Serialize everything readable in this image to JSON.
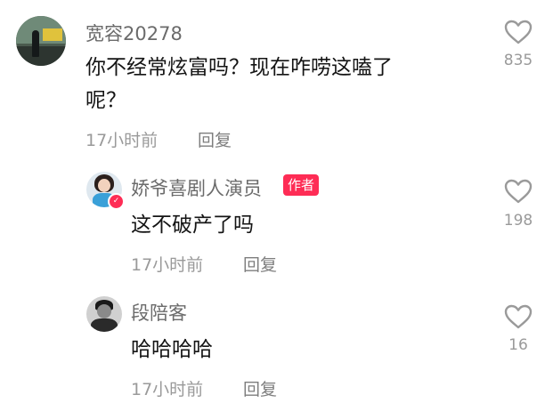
{
  "comments": [
    {
      "username": "宽容20278",
      "text_line1": "你不经常炫富吗？现在咋唠这嗑了",
      "text_line2": "呢？",
      "time": "17小时前",
      "reply_label": "回复",
      "like_count": "835",
      "icons": {
        "avatar": "user-avatar-icon",
        "like": "heart-icon"
      }
    },
    {
      "username": "娇爷喜剧人演员",
      "author_badge": "作者",
      "text": "这不破产了吗",
      "time": "17小时前",
      "reply_label": "回复",
      "like_count": "198",
      "icons": {
        "avatar": "user-avatar-icon",
        "verified": "verified-badge-icon",
        "like": "heart-icon"
      }
    },
    {
      "username": "段陪客",
      "text": "哈哈哈哈",
      "time": "17小时前",
      "reply_label": "回复",
      "like_count": "16",
      "icons": {
        "avatar": "user-avatar-icon",
        "like": "heart-icon"
      }
    }
  ],
  "colors": {
    "accent": "#fe2c55",
    "muted": "#9a9a9a",
    "text": "#141414"
  }
}
